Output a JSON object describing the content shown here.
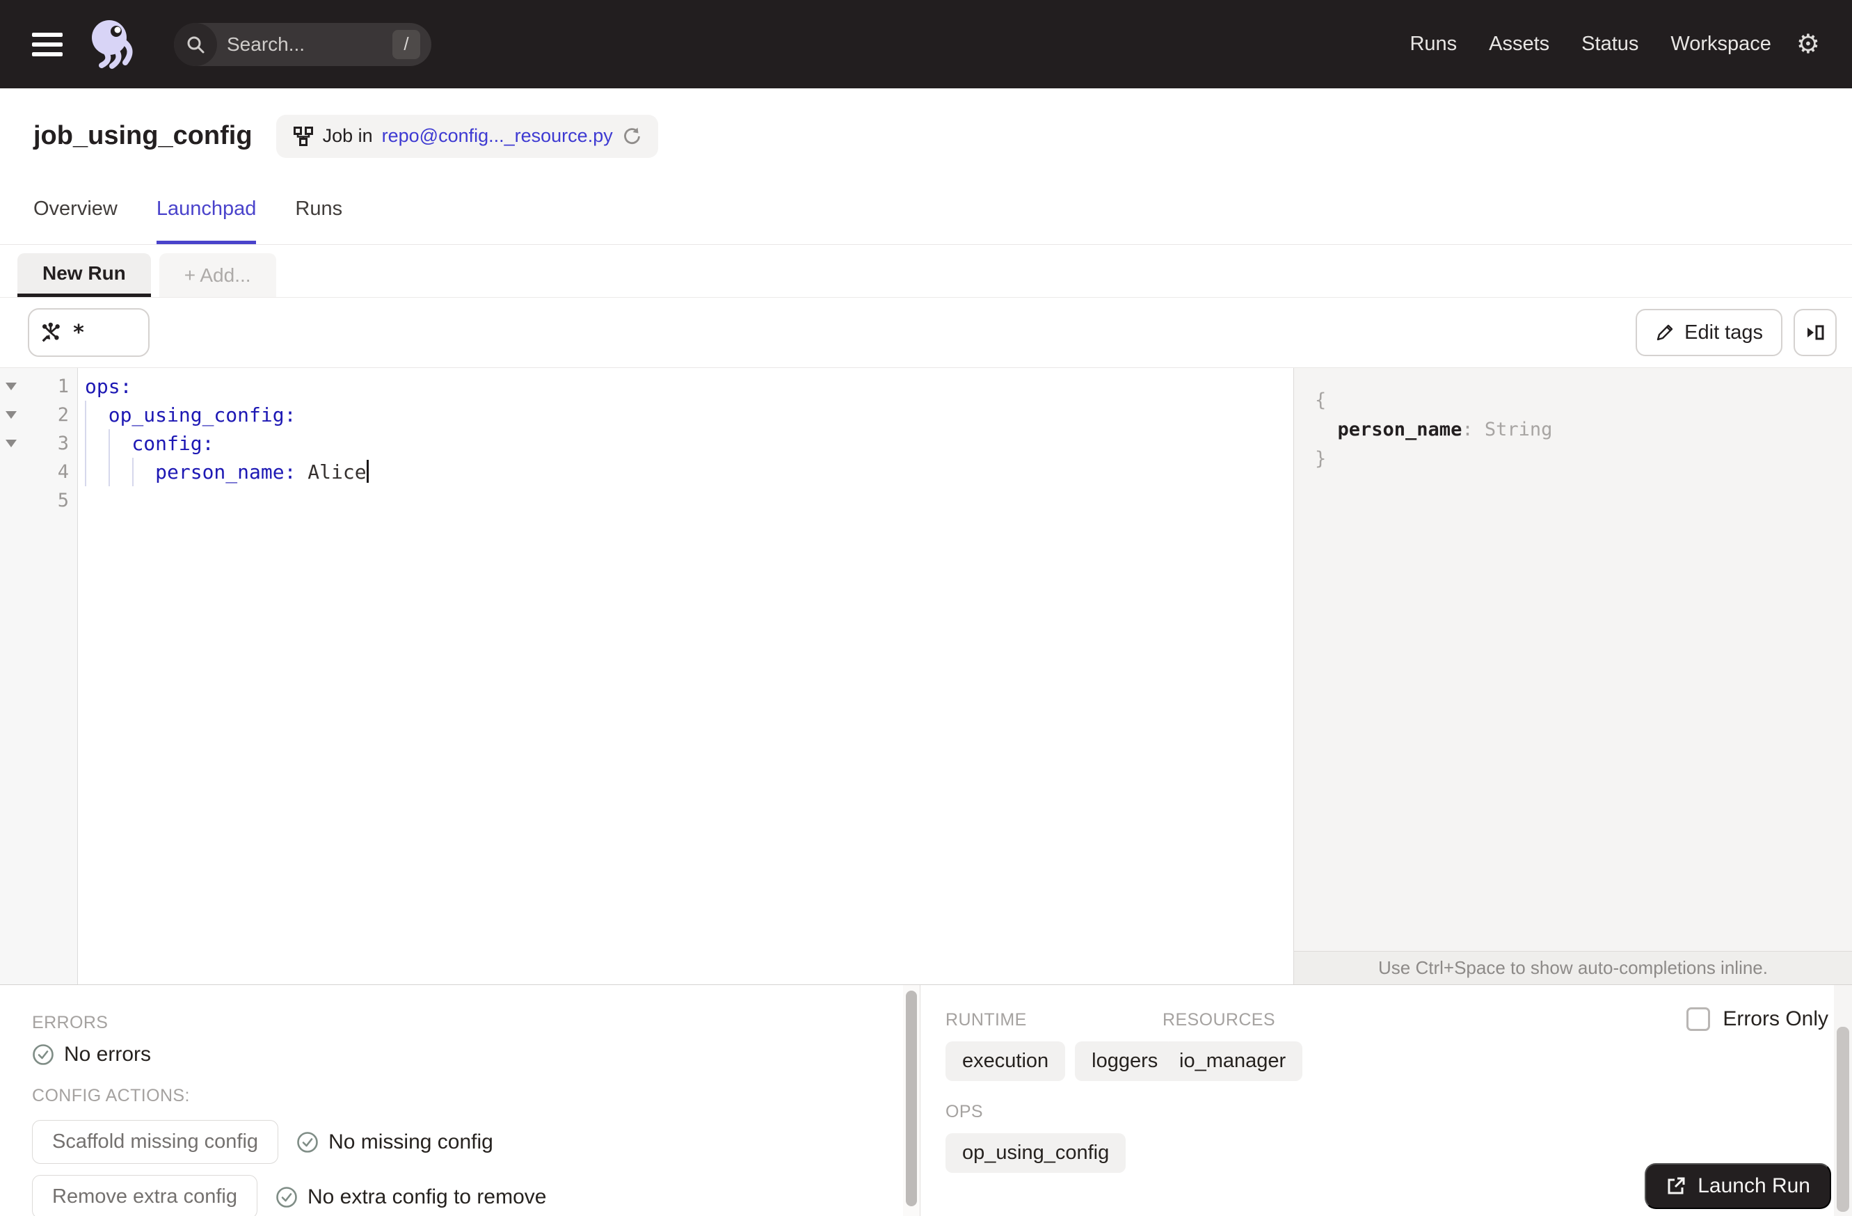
{
  "colors": {
    "accent": "#4a43cb",
    "link": "#3e3ad2",
    "navbar": "#221e1f",
    "code_key": "#1d18b4",
    "check_icon": "#7f8d86"
  },
  "nav": {
    "search_placeholder": "Search...",
    "search_shortcut": "/",
    "links": [
      "Runs",
      "Assets",
      "Status",
      "Workspace"
    ]
  },
  "header": {
    "title": "job_using_config",
    "badge_prefix": "Job in",
    "badge_link": "repo@config..._resource.py"
  },
  "tabs": {
    "overview": "Overview",
    "launchpad": "Launchpad",
    "runs": "Runs"
  },
  "run_tabs": {
    "new_run": "New Run",
    "add": "+ Add..."
  },
  "toolbar": {
    "op_selector_value": "*",
    "edit_tags": "Edit tags"
  },
  "editor": {
    "lines": [
      {
        "num": "1",
        "key": "ops:",
        "value": ""
      },
      {
        "num": "2",
        "key": "  op_using_config:",
        "value": ""
      },
      {
        "num": "3",
        "key": "    config:",
        "value": ""
      },
      {
        "num": "4",
        "key": "      person_name:",
        "value": " Alice"
      },
      {
        "num": "5",
        "key": "",
        "value": ""
      }
    ]
  },
  "schema": {
    "brace_open": "{",
    "key": "  person_name",
    "sep": ": ",
    "type": "String",
    "brace_close": "}",
    "hint": "Use Ctrl+Space to show auto-completions inline."
  },
  "panels": {
    "errors_label": "ERRORS",
    "no_errors": "No errors",
    "config_actions_label": "CONFIG ACTIONS:",
    "scaffold_button": "Scaffold missing config",
    "no_missing": "No missing config",
    "remove_button": "Remove extra config",
    "no_extra": "No extra config to remove",
    "runtime_label": "RUNTIME",
    "runtime_tags": [
      "execution",
      "loggers"
    ],
    "resources_label": "RESOURCES",
    "resources_tags": [
      "io_manager"
    ],
    "ops_label": "OPS",
    "ops_tags": [
      "op_using_config"
    ],
    "errors_only_label": "Errors Only",
    "launch_button": "Launch Run"
  }
}
